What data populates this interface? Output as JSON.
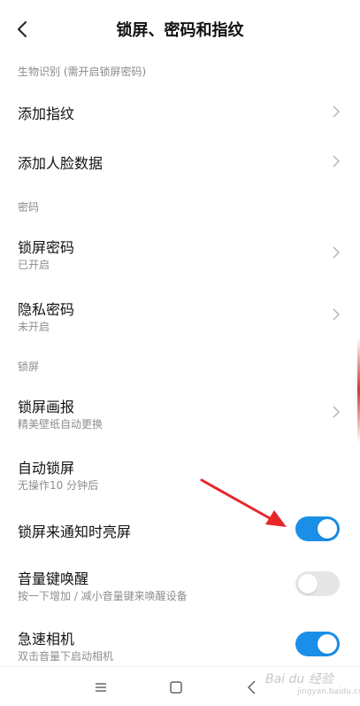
{
  "header": {
    "title": "锁屏、密码和指纹"
  },
  "sections": {
    "biometric": "生物识别 (需开启锁屏密码)",
    "password": "密码",
    "lockscreen": "锁屏"
  },
  "rows": {
    "add_fingerprint": {
      "title": "添加指纹"
    },
    "add_face": {
      "title": "添加人脸数据"
    },
    "lock_password": {
      "title": "锁屏密码",
      "sub": "已开启"
    },
    "privacy_password": {
      "title": "隐私密码",
      "sub": "未开启"
    },
    "lock_wallpaper": {
      "title": "锁屏画报",
      "sub": "精美壁纸自动更换"
    },
    "auto_lock": {
      "title": "自动锁屏",
      "sub": "无操作10 分钟后"
    },
    "wake_on_notification": {
      "title": "锁屏来通知时亮屏",
      "enabled": true
    },
    "volume_wake": {
      "title": "音量键唤醒",
      "sub": "按一下增加 / 减小音量键来唤醒设备",
      "enabled": false
    },
    "quick_camera": {
      "title": "急速相机",
      "sub": "双击音量下启动相机",
      "enabled": true
    }
  },
  "colors": {
    "toggle_on": "#1a8fe8",
    "toggle_off": "#e6e6e6",
    "annotation_arrow": "#e8262a"
  },
  "watermark": {
    "text": "Bai du 经验",
    "sub": "jingyan.baidu.com"
  }
}
